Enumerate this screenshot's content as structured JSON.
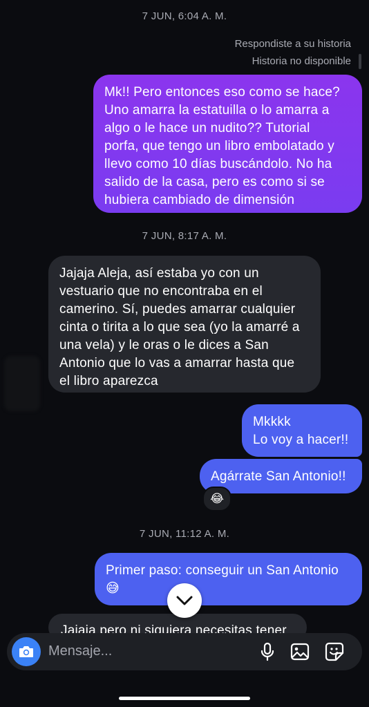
{
  "timestamps": [
    "7 JUN, 6:04 A. M.",
    "7 JUN, 8:17 A. M.",
    "7 JUN, 11:12 A. M."
  ],
  "story_reply": {
    "label": "Respondiste a su historia",
    "status": "Historia no disponible"
  },
  "messages": [
    {
      "from": "me",
      "lines": [
        "Mk!! Pero entonces eso como se hace?",
        "Uno amarra la estatuilla o lo amarra a",
        "algo o le hace un nudito?? Tutorial",
        "porfa, que tengo un libro embolatado y",
        "llevo como 10 días buscándolo. No ha",
        "salido de la casa, pero es como si se",
        "hubiera cambiado de dimensión"
      ]
    },
    {
      "from": "them",
      "lines": [
        "Jajaja Aleja, así estaba yo con un",
        "vestuario que no encontraba en el",
        "camerino. Sí, puedes amarrar cualquier",
        "cinta o tirita a lo que sea (yo la amarré a",
        "una vela) y le oras o le dices a San",
        "Antonio que lo vas a amarrar hasta que",
        "el libro aparezca"
      ]
    },
    {
      "from": "me",
      "lines": [
        "Mkkkk",
        "Lo voy a hacer!!"
      ]
    },
    {
      "from": "me",
      "lines": [
        "Agárrate San Antonio!!"
      ],
      "reaction": "😂"
    },
    {
      "from": "me",
      "lines": [
        "Primer paso: conseguir un San Antonio",
        "😅"
      ]
    },
    {
      "from": "them",
      "lines": [
        "Jajaja pero ni siquiera necesitas tener"
      ]
    }
  ],
  "composer": {
    "placeholder": "Mensaje..."
  },
  "icons": [
    "camera-icon",
    "microphone-icon",
    "gallery-icon",
    "sticker-icon",
    "chevron-down-icon"
  ],
  "colors": {
    "purple_bubble": "#8b35ee",
    "blue_bubble": "#4d61f0",
    "grey_bubble": "#26282e",
    "camera": "#3b82f6"
  }
}
